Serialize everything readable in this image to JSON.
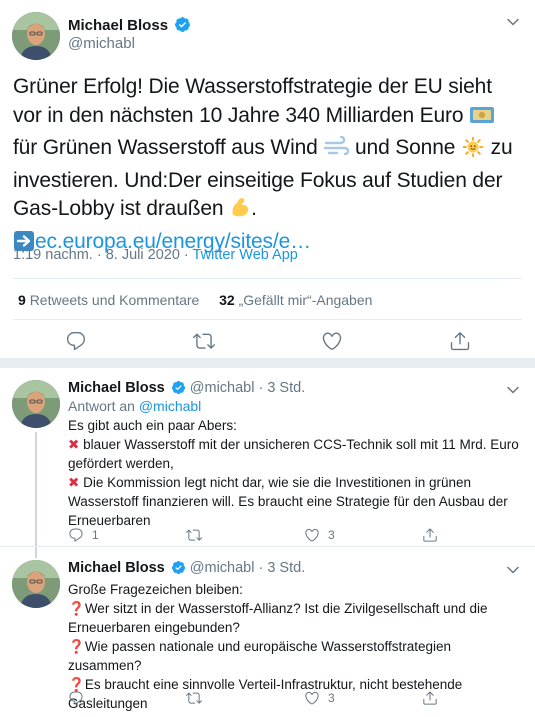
{
  "main_tweet": {
    "author_name": "Michael Bloss",
    "author_handle": "@michabl",
    "text_part1": "Grüner Erfolg! Die Wasserstoffstrategie der EU sieht vor in den nächsten 10 Jahre 340 Milliarden Euro ",
    "text_part2": " für Grünen Wasserstoff aus Wind ",
    "text_part3": " und Sonne ",
    "text_part4": " zu investieren. Und:Der einseitige Fokus auf Studien der Gas-Lobby ist draußen ",
    "text_part5": ".",
    "link_text": "ec.europa.eu/energy/sites/e…",
    "time": "1:19 nachm.",
    "dot": "·",
    "date": "8. Juli 2020",
    "source": "Twitter Web App",
    "retweets_count": "9",
    "retweets_label": "Retweets und Kommentare",
    "likes_count": "32",
    "likes_label": "„Gefällt mir“-Angaben",
    "icons": [
      "reply-icon",
      "retweet-icon",
      "like-icon",
      "share-icon"
    ]
  },
  "replies": [
    {
      "author_name": "Michael Bloss",
      "author_handle": "@michabl",
      "time": "· 3 Std.",
      "reply_prefix": "Antwort an",
      "reply_to": "@michabl",
      "intro": "Es gibt auch ein paar Abers:",
      "point1": "blauer Wasserstoff mit der unsicheren CCS-Technik soll mit 11 Mrd. Euro gefördert werden,",
      "point2": "Die Kommission legt nicht dar, wie sie die Investitionen in grünen Wasserstoff finanzieren will. Es braucht eine Strategie für den Ausbau der Erneuerbaren",
      "reply_count": "1",
      "retweet_count": "",
      "like_count": "3"
    },
    {
      "author_name": "Michael Bloss",
      "author_handle": "@michabl",
      "time": "· 3 Std.",
      "intro": "Große Fragezeichen bleiben:",
      "point1": "Wer sitzt in der Wasserstoff-Allianz? Ist die Zivilgesellschaft und die Erneuerbaren eingebunden?",
      "point2": "Wie passen nationale und europäische Wasserstoffstrategien zusammen?",
      "point3": "Es braucht eine sinnvolle Verteil-Infrastruktur, nicht bestehende Gasleitungen",
      "reply_count": "",
      "retweet_count": "",
      "like_count": "3"
    }
  ],
  "colors": {
    "accent": "#1b95e0",
    "verified": "#1da1f2",
    "secondary_text": "#657786",
    "divider": "#e6ecf0",
    "red_mark": "#dd2e44"
  }
}
